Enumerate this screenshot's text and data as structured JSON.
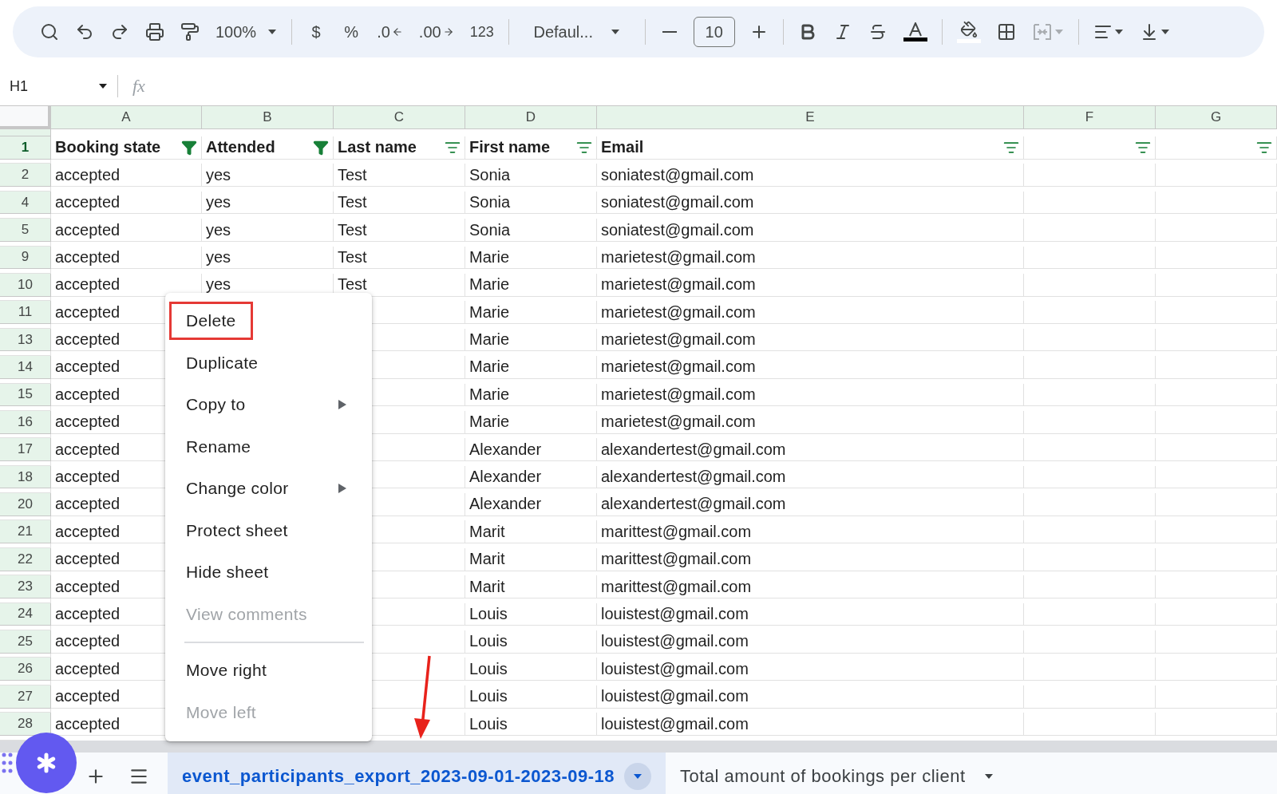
{
  "toolbar": {
    "zoom": "100%",
    "currency": "$",
    "percent": "%",
    "decrease_decimal": ".0",
    "increase_decimal": ".00",
    "number_format": "123",
    "font": "Defaul...",
    "font_size": "10",
    "merge_disabled": true
  },
  "formula_bar": {
    "cell_ref": "H1",
    "fx_label": "fx"
  },
  "header_row_num": "1",
  "columns": [
    {
      "letter": "A",
      "header": "Booking state",
      "filtered": true
    },
    {
      "letter": "B",
      "header": "Attended",
      "filtered": true
    },
    {
      "letter": "C",
      "header": "Last name",
      "filtered": false
    },
    {
      "letter": "D",
      "header": "First name",
      "filtered": false
    },
    {
      "letter": "E",
      "header": "Email",
      "filtered": false
    },
    {
      "letter": "F",
      "filtered": false
    },
    {
      "letter": "G",
      "filtered": false
    }
  ],
  "rows": [
    {
      "num": "2",
      "cells": [
        "accepted",
        "yes",
        "Test",
        "Sonia",
        "soniatest@gmail.com"
      ]
    },
    {
      "num": "4",
      "cells": [
        "accepted",
        "yes",
        "Test",
        "Sonia",
        "soniatest@gmail.com"
      ]
    },
    {
      "num": "5",
      "cells": [
        "accepted",
        "yes",
        "Test",
        "Sonia",
        "soniatest@gmail.com"
      ]
    },
    {
      "num": "9",
      "cells": [
        "accepted",
        "yes",
        "Test",
        "Marie",
        "marietest@gmail.com"
      ]
    },
    {
      "num": "10",
      "cells": [
        "accepted",
        "yes",
        "Test",
        "Marie",
        "marietest@gmail.com"
      ]
    },
    {
      "num": "11",
      "cells": [
        "accepted",
        null,
        null,
        "Marie",
        "marietest@gmail.com"
      ]
    },
    {
      "num": "13",
      "cells": [
        "accepted",
        null,
        null,
        "Marie",
        "marietest@gmail.com"
      ]
    },
    {
      "num": "14",
      "cells": [
        "accepted",
        null,
        null,
        "Marie",
        "marietest@gmail.com"
      ]
    },
    {
      "num": "15",
      "cells": [
        "accepted",
        null,
        null,
        "Marie",
        "marietest@gmail.com"
      ]
    },
    {
      "num": "16",
      "cells": [
        "accepted",
        null,
        null,
        "Marie",
        "marietest@gmail.com"
      ]
    },
    {
      "num": "17",
      "cells": [
        "accepted",
        null,
        null,
        "Alexander",
        "alexandertest@gmail.com"
      ]
    },
    {
      "num": "18",
      "cells": [
        "accepted",
        null,
        null,
        "Alexander",
        "alexandertest@gmail.com"
      ]
    },
    {
      "num": "20",
      "cells": [
        "accepted",
        null,
        null,
        "Alexander",
        "alexandertest@gmail.com"
      ]
    },
    {
      "num": "21",
      "cells": [
        "accepted",
        null,
        null,
        "Marit",
        "marittest@gmail.com"
      ]
    },
    {
      "num": "22",
      "cells": [
        "accepted",
        null,
        null,
        "Marit",
        "marittest@gmail.com"
      ]
    },
    {
      "num": "23",
      "cells": [
        "accepted",
        null,
        null,
        "Marit",
        "marittest@gmail.com"
      ]
    },
    {
      "num": "24",
      "cells": [
        "accepted",
        null,
        null,
        "Louis",
        "louistest@gmail.com"
      ]
    },
    {
      "num": "25",
      "cells": [
        "accepted",
        null,
        null,
        "Louis",
        "louistest@gmail.com"
      ]
    },
    {
      "num": "26",
      "cells": [
        "accepted",
        null,
        null,
        "Louis",
        "louistest@gmail.com"
      ]
    },
    {
      "num": "27",
      "cells": [
        "accepted",
        null,
        null,
        "Louis",
        "louistest@gmail.com"
      ]
    },
    {
      "num": "28",
      "cells": [
        "accepted",
        null,
        null,
        "Louis",
        "louistest@gmail.com"
      ]
    }
  ],
  "context_menu": {
    "items": [
      {
        "kind": "item",
        "label": "Delete",
        "disabled": false,
        "submenu": false,
        "outlined": true
      },
      {
        "kind": "item",
        "label": "Duplicate",
        "disabled": false,
        "submenu": false,
        "outlined": false
      },
      {
        "kind": "item",
        "label": "Copy to",
        "disabled": false,
        "submenu": true,
        "outlined": false
      },
      {
        "kind": "item",
        "label": "Rename",
        "disabled": false,
        "submenu": false,
        "outlined": false
      },
      {
        "kind": "item",
        "label": "Change color",
        "disabled": false,
        "submenu": true,
        "outlined": false
      },
      {
        "kind": "item",
        "label": "Protect sheet",
        "disabled": false,
        "submenu": false,
        "outlined": false
      },
      {
        "kind": "item",
        "label": "Hide sheet",
        "disabled": false,
        "submenu": false,
        "outlined": false
      },
      {
        "kind": "item",
        "label": "View comments",
        "disabled": true,
        "submenu": false,
        "outlined": false
      },
      {
        "kind": "divider"
      },
      {
        "kind": "item",
        "label": "Move right",
        "disabled": false,
        "submenu": false,
        "outlined": false
      },
      {
        "kind": "item",
        "label": "Move left",
        "disabled": true,
        "submenu": false,
        "outlined": false
      }
    ]
  },
  "sheet_tabs": [
    {
      "label": "event_participants_export_2023-09-01-2023-09-18",
      "selected": true
    },
    {
      "label": "Total amount of bookings per client",
      "selected": false
    }
  ]
}
